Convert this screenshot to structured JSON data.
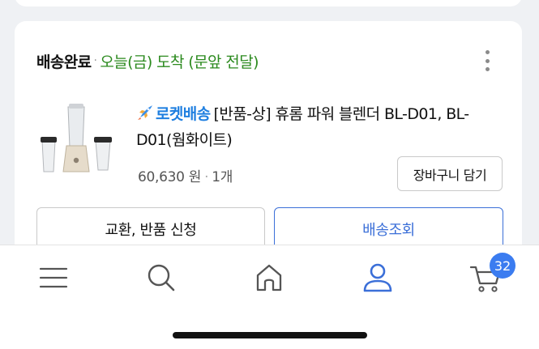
{
  "order": {
    "status": "배송완료",
    "separator": "·",
    "arrival": "오늘(금) 도착 (문앞 전달)",
    "product": {
      "badge_label": "로켓배송",
      "name": "[반품-상] 휴롬 파워 블렌더 BL-D01, BL-D01(웜화이트)",
      "price": "60,630 원",
      "quantity": "1개",
      "price_separator": "·"
    },
    "add_to_cart_label": "장바구니 담기",
    "exchange_label": "교환, 반품 신청",
    "track_label": "배송조회"
  },
  "tabbar": {
    "cart_count": "32",
    "active_tab": "mypage",
    "icons": [
      "menu-icon",
      "search-icon",
      "home-icon",
      "user-icon",
      "cart-icon"
    ]
  },
  "colors": {
    "arrival_green": "#2b8a1e",
    "rocket_blue": "#1f7fe0",
    "accent_blue": "#3b6fd8",
    "badge_blue": "#3b7cf0"
  }
}
